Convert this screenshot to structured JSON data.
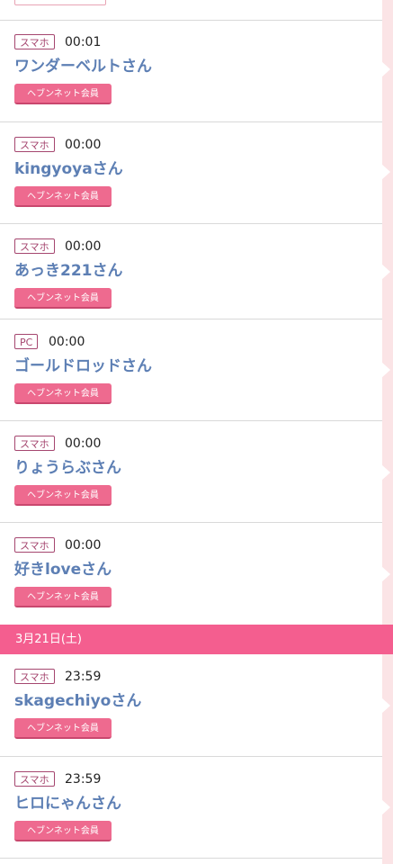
{
  "date_header": "3月21日(土)",
  "entries_before": [
    {
      "device": "スマホ",
      "time": "00:01",
      "name": "ワンダーベルトさん",
      "badge": "ヘブンネット会員"
    },
    {
      "device": "スマホ",
      "time": "00:00",
      "name": "kingyoyaさん",
      "badge": "ヘブンネット会員"
    },
    {
      "device": "スマホ",
      "time": "00:00",
      "name": "あっき221さん",
      "badge": "ヘブンネット会員"
    },
    {
      "device": "PC",
      "time": "00:00",
      "name": "ゴールドロッドさん",
      "badge": "ヘブンネット会員"
    },
    {
      "device": "スマホ",
      "time": "00:00",
      "name": "りょうらぶさん",
      "badge": "ヘブンネット会員"
    },
    {
      "device": "スマホ",
      "time": "00:00",
      "name": "好きloveさん",
      "badge": "ヘブンネット会員"
    }
  ],
  "entries_after": [
    {
      "device": "スマホ",
      "time": "23:59",
      "name": "skagechiyoさん",
      "badge": "ヘブンネット会員"
    },
    {
      "device": "スマホ",
      "time": "23:59",
      "name": "ヒロにゃんさん",
      "badge": "ヘブンネット会員"
    }
  ],
  "colors": {
    "date_bar": "#f45e8f",
    "member_badge": "#ee6a8f",
    "name_text": "#5d7fb4",
    "device_border": "#a5466f",
    "side_rail": "#fbe4e6"
  }
}
